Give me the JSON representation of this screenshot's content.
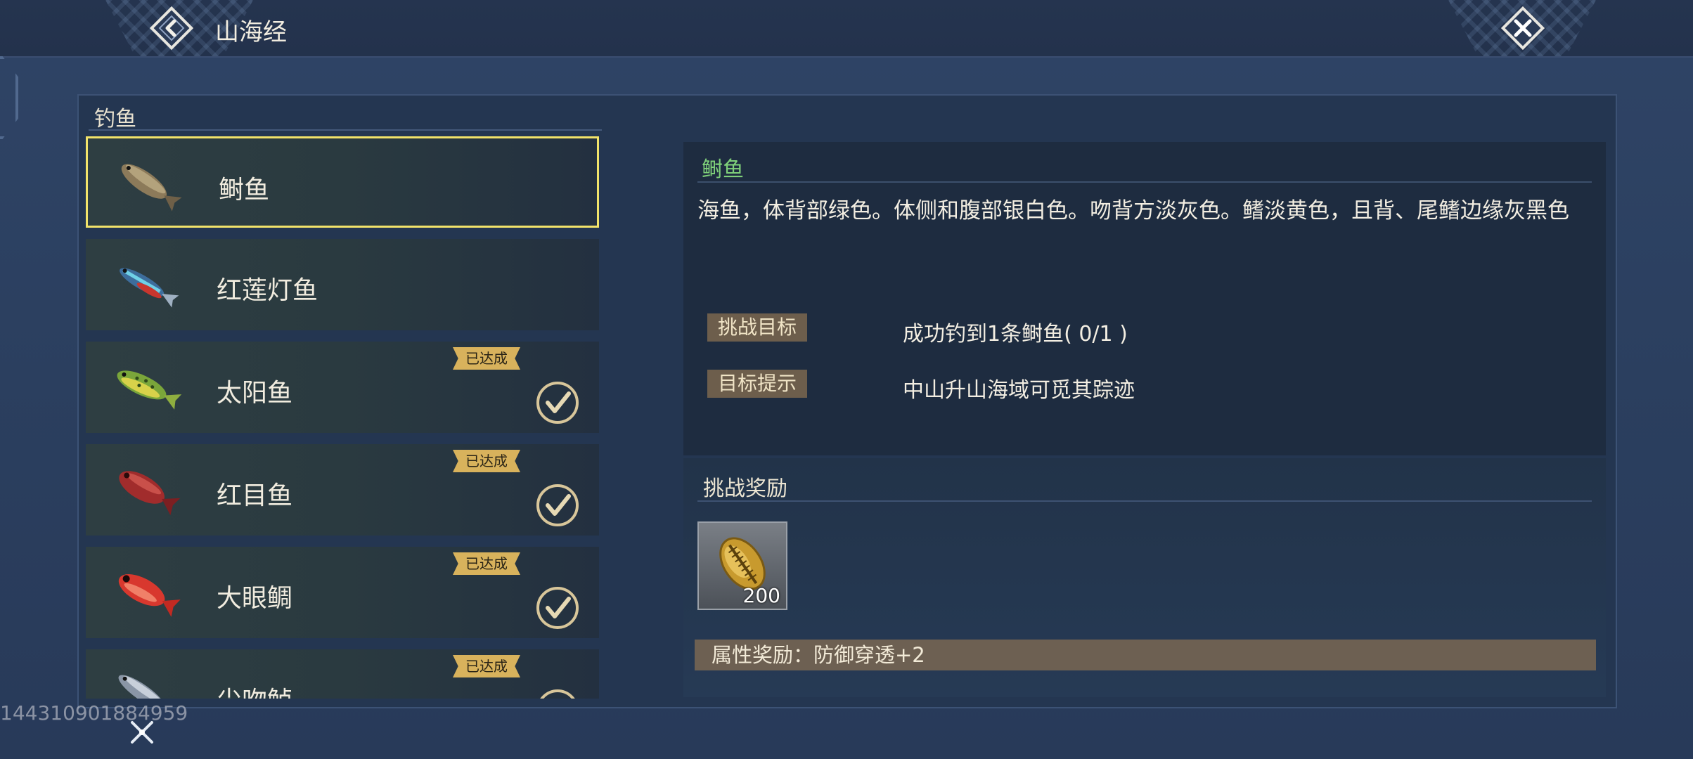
{
  "header": {
    "title": "山海经",
    "back_icon": "back-arrow-icon",
    "close_icon": "close-icon"
  },
  "panel": {
    "section_title": "钓鱼",
    "fish_list": [
      {
        "name": "鲥鱼",
        "selected": true,
        "completed": false,
        "badge": ""
      },
      {
        "name": "红莲灯鱼",
        "selected": false,
        "completed": false,
        "badge": ""
      },
      {
        "name": "太阳鱼",
        "selected": false,
        "completed": true,
        "badge": "已达成"
      },
      {
        "name": "红目鱼",
        "selected": false,
        "completed": true,
        "badge": "已达成"
      },
      {
        "name": "大眼鲷",
        "selected": false,
        "completed": true,
        "badge": "已达成"
      },
      {
        "name": "尖吻鲈",
        "selected": false,
        "completed": true,
        "badge": "已达成"
      }
    ]
  },
  "detail": {
    "name": "鲥鱼",
    "description": "海鱼，体背部绿色。体侧和腹部银白色。吻背方淡灰色。鳍淡黄色，且背、尾鳍边缘灰黑色",
    "goal_label": "挑战目标",
    "goal_text": "成功钓到1条鲥鱼( 0/1 )",
    "hint_label": "目标提示",
    "hint_text": "中山升山海域可觅其踪迹"
  },
  "reward": {
    "title": "挑战奖励",
    "item_quantity": "200",
    "item_icon": "shell-coin-icon",
    "attribute": "属性奖励：防御穿透+2"
  },
  "footer": {
    "uid": "144310901884959"
  },
  "colors": {
    "accent_green": "#7fd07a",
    "selected_border": "#f2e36a",
    "badge_gold": "#d8b25c"
  }
}
